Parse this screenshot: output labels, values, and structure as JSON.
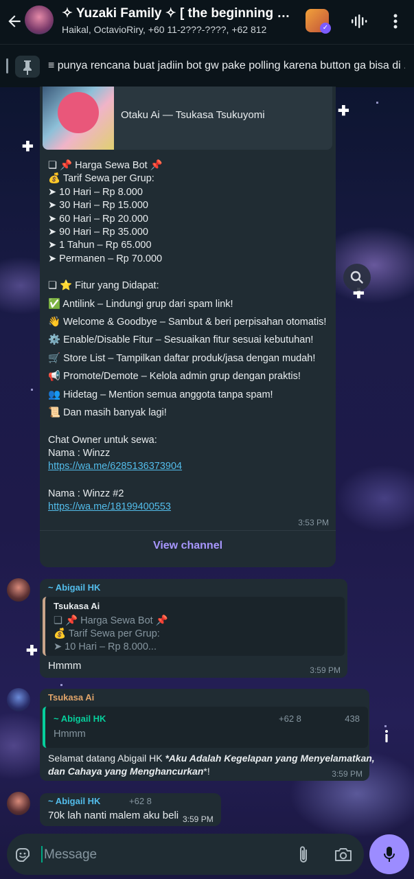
{
  "header": {
    "title": "✧ Yuzaki Family ✧ [ the beginning of our story ]",
    "subtitle": "Haikal, OctavioRiry, +60 11-2???-????, +62 812"
  },
  "pinned": {
    "text": "≡ punya rencana buat jadiin bot gw pake polling karena button ga bisa di ..."
  },
  "channel_post": {
    "preview_title": "Otaku Ai — Tsukasa Tsukuyomi",
    "lines": [
      "❏ 📌 Harga Sewa Bot 📌",
      "💰 Tarif Sewa per Grup:",
      "➤ 10 Hari – Rp 8.000",
      "➤ 30 Hari – Rp 15.000",
      "➤ 60 Hari – Rp 20.000",
      "➤ 90 Hari – Rp 35.000",
      "➤ 1 Tahun – Rp 65.000",
      "➤ Permanen – Rp 70.000",
      "",
      "❏ ⭐ Fitur yang Didapat:",
      "✅ Antilink – Lindungi grup dari spam link!",
      "👋 Welcome & Goodbye – Sambut & beri perpisahan otomatis!",
      "⚙️ Enable/Disable Fitur – Sesuaikan fitur sesuai kebutuhan!",
      "🛒 Store List – Tampilkan daftar produk/jasa dengan mudah!",
      "📢 Promote/Demote – Kelola admin grup dengan praktis!",
      "👥 Hidetag – Mention semua anggota tanpa spam!",
      "📜 Dan masih banyak lagi!",
      "",
      "Chat Owner untuk sewa:",
      "Nama : Winzz"
    ],
    "link1": "https://wa.me/6285136373904",
    "name2": "Nama : Winzz #2",
    "link2": "https://wa.me/18199400553",
    "time": "3:53 PM",
    "view_channel": "View channel"
  },
  "msg1": {
    "sender": "~ Abigail HK",
    "quote_sender": "Tsukasa Ai",
    "quote_lines": [
      "❏ 📌 Harga Sewa Bot 📌",
      "💰 Tarif Sewa per Grup:",
      "➤ 10 Hari – Rp 8.000..."
    ],
    "text": "Hmmm",
    "time": "3:59 PM"
  },
  "msg2": {
    "sender": "Tsukasa Ai",
    "quote_sender": "~ Abigail HK",
    "quote_phone_left": "+62 8",
    "quote_phone_right": "438",
    "quote_text": "Hmmm",
    "text_line1_a": "Selamat datang Abigail HK ",
    "text_line1_b": "*Aku Adalah Kegelapan yang Menyelamatkan,",
    "text_line2_a": "dan Cahaya yang Menghancurkan",
    "text_line2_b": "*!",
    "time": "3:59 PM"
  },
  "msg3": {
    "sender": "~ Abigail HK",
    "phone": "+62 8",
    "text": "70k lah nanti malem aku beli",
    "time": "3:59 PM"
  },
  "input": {
    "placeholder": "Message"
  },
  "colors": {
    "accent": "#9c8cff",
    "link": "#53bdeb",
    "bubble": "#202c33"
  }
}
